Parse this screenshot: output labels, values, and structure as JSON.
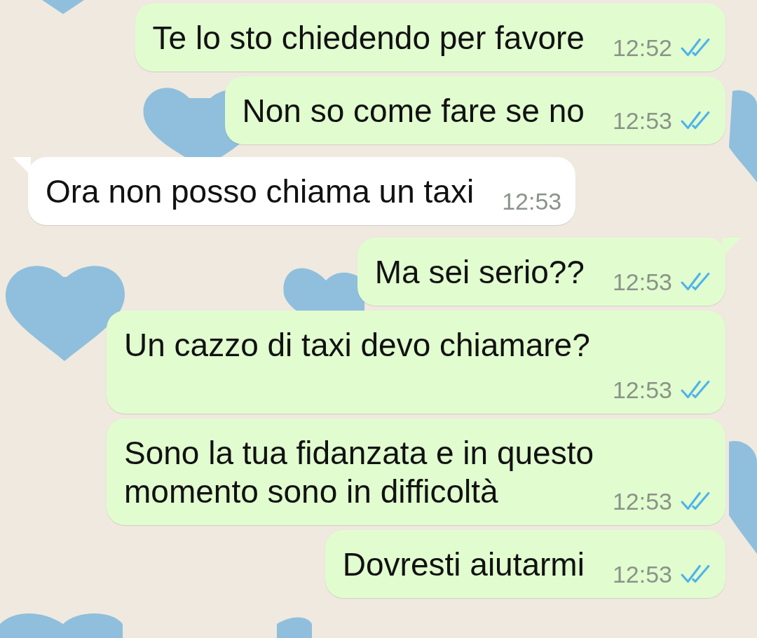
{
  "messages": [
    {
      "text": "Te lo sto chiedendo per favore",
      "time": "12:52",
      "outgoing": true,
      "tail": false,
      "kind": "inline",
      "read": true
    },
    {
      "text": "Non so come fare se no",
      "time": "12:53",
      "outgoing": true,
      "tail": false,
      "kind": "inline",
      "read": true
    },
    {
      "text": "Ora non posso chiama un taxi",
      "time": "12:53",
      "outgoing": false,
      "tail": true,
      "kind": "inline"
    },
    {
      "text": "Ma sei serio??",
      "time": "12:53",
      "outgoing": true,
      "tail": true,
      "kind": "inline",
      "read": true
    },
    {
      "text": "Un cazzo di taxi devo chiamare?",
      "time": "12:53",
      "outgoing": true,
      "tail": false,
      "kind": "stacked",
      "read": true
    },
    {
      "text": "Sono la tua fidanzata e in questo momento sono in difficoltà",
      "time": "12:53",
      "outgoing": true,
      "tail": false,
      "kind": "wrapped",
      "read": true
    },
    {
      "text": "Dovresti aiutarmi",
      "time": "12:53",
      "outgoing": true,
      "tail": false,
      "kind": "inline",
      "read": true
    }
  ]
}
